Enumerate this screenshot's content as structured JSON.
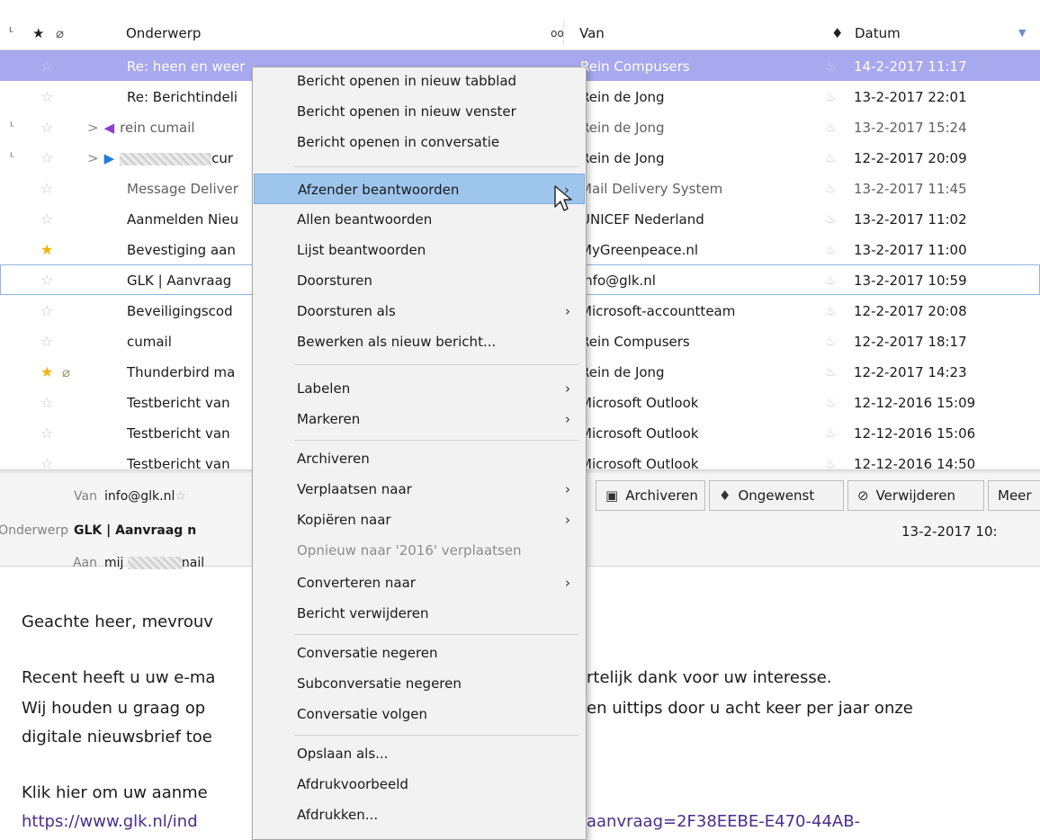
{
  "columns": {
    "thread_icon": "thread-icon",
    "star_icon": "star-icon",
    "attachment_icon": "attachment-icon",
    "subject": "Onderwerp",
    "from_icon": "correspondents-icon",
    "from": "Van",
    "junk_icon": "junk-flame-icon",
    "date": "Datum"
  },
  "messages": [
    {
      "subject": "Re: heen en weer",
      "from": "Rein Compusers",
      "date": "14-2-2017 11:17"
    },
    {
      "subject": "Re: Berichtindeli",
      "from": "Rein de Jong",
      "date": "13-2-2017 22:01"
    },
    {
      "subject": "rein cumail",
      "from": "Rein de Jong",
      "date": "13-2-2017 15:24"
    },
    {
      "subject": "cur",
      "from": "Rein de Jong",
      "date": "12-2-2017 20:09"
    },
    {
      "subject": "Message Deliver",
      "from": "Mail Delivery System",
      "date": "13-2-2017 11:45"
    },
    {
      "subject": "Aanmelden Nieu",
      "from": "UNICEF Nederland",
      "date": "13-2-2017 11:02"
    },
    {
      "subject": "Bevestiging aan",
      "from": "MyGreenpeace.nl",
      "date": "13-2-2017 11:00"
    },
    {
      "subject": "GLK | Aanvraag",
      "from": "info@glk.nl",
      "date": "13-2-2017 10:59"
    },
    {
      "subject": "Beveiligingscod",
      "from": "Microsoft-accountteam",
      "date": "12-2-2017 20:08"
    },
    {
      "subject": "cumail",
      "from": "Rein Compusers",
      "date": "12-2-2017 18:17"
    },
    {
      "subject": "Thunderbird ma",
      "from": "Rein de Jong",
      "date": "12-2-2017 14:23"
    },
    {
      "subject": "Testbericht van",
      "from": "Microsoft Outlook",
      "date": "12-12-2016 15:09"
    },
    {
      "subject": "Testbericht van",
      "from": "Microsoft Outlook",
      "date": "12-12-2016 15:06"
    },
    {
      "subject": "Testbericht van",
      "from": "Microsoft Outlook",
      "date": "12-12-2016 14:50"
    }
  ],
  "header": {
    "from_label": "Van",
    "from_value": "info@glk.nl",
    "subject_label": "Onderwerp",
    "subject_value": "GLK | Aanvraag n",
    "to_label": "Aan",
    "to_value_prefix": "mij",
    "to_value_suffix": "nail",
    "date_value": "13-2-2017 10:",
    "buttons": {
      "archive": "Archiveren",
      "junk": "Ongewenst",
      "delete": "Verwijderen",
      "more": "Meer"
    }
  },
  "body": {
    "line1": "Geachte heer, mevrouv",
    "line2a": "Recent heeft u uw e-ma",
    "line2b": "rtelijk dank voor uw interesse.",
    "line3a": "Wij houden u graag op",
    "line3b": "en uittips door u acht keer per jaar onze",
    "line4a": "digitale nieuwsbrief toe",
    "line5a": "Klik hier om uw aanme",
    "line6a": "https://www.glk.nl/ind",
    "line6b": "aanvraag=2F38EEBE-E470-44AB-"
  },
  "context_menu": {
    "open_tab": "Bericht openen in nieuw tabblad",
    "open_window": "Bericht openen in nieuw venster",
    "open_conversation": "Bericht openen in conversatie",
    "reply_sender": "Afzender beantwoorden",
    "reply_all": "Allen beantwoorden",
    "reply_list": "Lijst beantwoorden",
    "forward": "Doorsturen",
    "forward_as": "Doorsturen als",
    "edit_new": "Bewerken als nieuw bericht...",
    "tag": "Labelen",
    "mark": "Markeren",
    "archive": "Archiveren",
    "move_to": "Verplaatsen naar",
    "copy_to": "Kopiëren naar",
    "move_again": "Opnieuw naar '2016' verplaatsen",
    "convert_to": "Converteren naar",
    "delete": "Bericht verwijderen",
    "ignore_thread": "Conversatie negeren",
    "ignore_subthread": "Subconversatie negeren",
    "watch_thread": "Conversatie volgen",
    "save_as": "Opslaan als...",
    "print_preview": "Afdrukvoorbeeld",
    "print": "Afdrukken..."
  }
}
